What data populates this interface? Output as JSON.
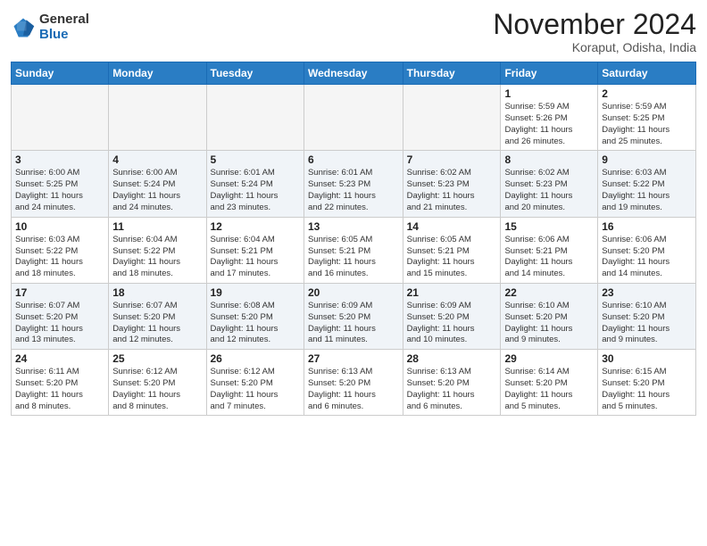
{
  "header": {
    "logo_general": "General",
    "logo_blue": "Blue",
    "month_title": "November 2024",
    "location": "Koraput, Odisha, India"
  },
  "weekdays": [
    "Sunday",
    "Monday",
    "Tuesday",
    "Wednesday",
    "Thursday",
    "Friday",
    "Saturday"
  ],
  "weeks": [
    [
      {
        "day": "",
        "info": ""
      },
      {
        "day": "",
        "info": ""
      },
      {
        "day": "",
        "info": ""
      },
      {
        "day": "",
        "info": ""
      },
      {
        "day": "",
        "info": ""
      },
      {
        "day": "1",
        "info": "Sunrise: 5:59 AM\nSunset: 5:26 PM\nDaylight: 11 hours\nand 26 minutes."
      },
      {
        "day": "2",
        "info": "Sunrise: 5:59 AM\nSunset: 5:25 PM\nDaylight: 11 hours\nand 25 minutes."
      }
    ],
    [
      {
        "day": "3",
        "info": "Sunrise: 6:00 AM\nSunset: 5:25 PM\nDaylight: 11 hours\nand 24 minutes."
      },
      {
        "day": "4",
        "info": "Sunrise: 6:00 AM\nSunset: 5:24 PM\nDaylight: 11 hours\nand 24 minutes."
      },
      {
        "day": "5",
        "info": "Sunrise: 6:01 AM\nSunset: 5:24 PM\nDaylight: 11 hours\nand 23 minutes."
      },
      {
        "day": "6",
        "info": "Sunrise: 6:01 AM\nSunset: 5:23 PM\nDaylight: 11 hours\nand 22 minutes."
      },
      {
        "day": "7",
        "info": "Sunrise: 6:02 AM\nSunset: 5:23 PM\nDaylight: 11 hours\nand 21 minutes."
      },
      {
        "day": "8",
        "info": "Sunrise: 6:02 AM\nSunset: 5:23 PM\nDaylight: 11 hours\nand 20 minutes."
      },
      {
        "day": "9",
        "info": "Sunrise: 6:03 AM\nSunset: 5:22 PM\nDaylight: 11 hours\nand 19 minutes."
      }
    ],
    [
      {
        "day": "10",
        "info": "Sunrise: 6:03 AM\nSunset: 5:22 PM\nDaylight: 11 hours\nand 18 minutes."
      },
      {
        "day": "11",
        "info": "Sunrise: 6:04 AM\nSunset: 5:22 PM\nDaylight: 11 hours\nand 18 minutes."
      },
      {
        "day": "12",
        "info": "Sunrise: 6:04 AM\nSunset: 5:21 PM\nDaylight: 11 hours\nand 17 minutes."
      },
      {
        "day": "13",
        "info": "Sunrise: 6:05 AM\nSunset: 5:21 PM\nDaylight: 11 hours\nand 16 minutes."
      },
      {
        "day": "14",
        "info": "Sunrise: 6:05 AM\nSunset: 5:21 PM\nDaylight: 11 hours\nand 15 minutes."
      },
      {
        "day": "15",
        "info": "Sunrise: 6:06 AM\nSunset: 5:21 PM\nDaylight: 11 hours\nand 14 minutes."
      },
      {
        "day": "16",
        "info": "Sunrise: 6:06 AM\nSunset: 5:20 PM\nDaylight: 11 hours\nand 14 minutes."
      }
    ],
    [
      {
        "day": "17",
        "info": "Sunrise: 6:07 AM\nSunset: 5:20 PM\nDaylight: 11 hours\nand 13 minutes."
      },
      {
        "day": "18",
        "info": "Sunrise: 6:07 AM\nSunset: 5:20 PM\nDaylight: 11 hours\nand 12 minutes."
      },
      {
        "day": "19",
        "info": "Sunrise: 6:08 AM\nSunset: 5:20 PM\nDaylight: 11 hours\nand 12 minutes."
      },
      {
        "day": "20",
        "info": "Sunrise: 6:09 AM\nSunset: 5:20 PM\nDaylight: 11 hours\nand 11 minutes."
      },
      {
        "day": "21",
        "info": "Sunrise: 6:09 AM\nSunset: 5:20 PM\nDaylight: 11 hours\nand 10 minutes."
      },
      {
        "day": "22",
        "info": "Sunrise: 6:10 AM\nSunset: 5:20 PM\nDaylight: 11 hours\nand 9 minutes."
      },
      {
        "day": "23",
        "info": "Sunrise: 6:10 AM\nSunset: 5:20 PM\nDaylight: 11 hours\nand 9 minutes."
      }
    ],
    [
      {
        "day": "24",
        "info": "Sunrise: 6:11 AM\nSunset: 5:20 PM\nDaylight: 11 hours\nand 8 minutes."
      },
      {
        "day": "25",
        "info": "Sunrise: 6:12 AM\nSunset: 5:20 PM\nDaylight: 11 hours\nand 8 minutes."
      },
      {
        "day": "26",
        "info": "Sunrise: 6:12 AM\nSunset: 5:20 PM\nDaylight: 11 hours\nand 7 minutes."
      },
      {
        "day": "27",
        "info": "Sunrise: 6:13 AM\nSunset: 5:20 PM\nDaylight: 11 hours\nand 6 minutes."
      },
      {
        "day": "28",
        "info": "Sunrise: 6:13 AM\nSunset: 5:20 PM\nDaylight: 11 hours\nand 6 minutes."
      },
      {
        "day": "29",
        "info": "Sunrise: 6:14 AM\nSunset: 5:20 PM\nDaylight: 11 hours\nand 5 minutes."
      },
      {
        "day": "30",
        "info": "Sunrise: 6:15 AM\nSunset: 5:20 PM\nDaylight: 11 hours\nand 5 minutes."
      }
    ]
  ]
}
